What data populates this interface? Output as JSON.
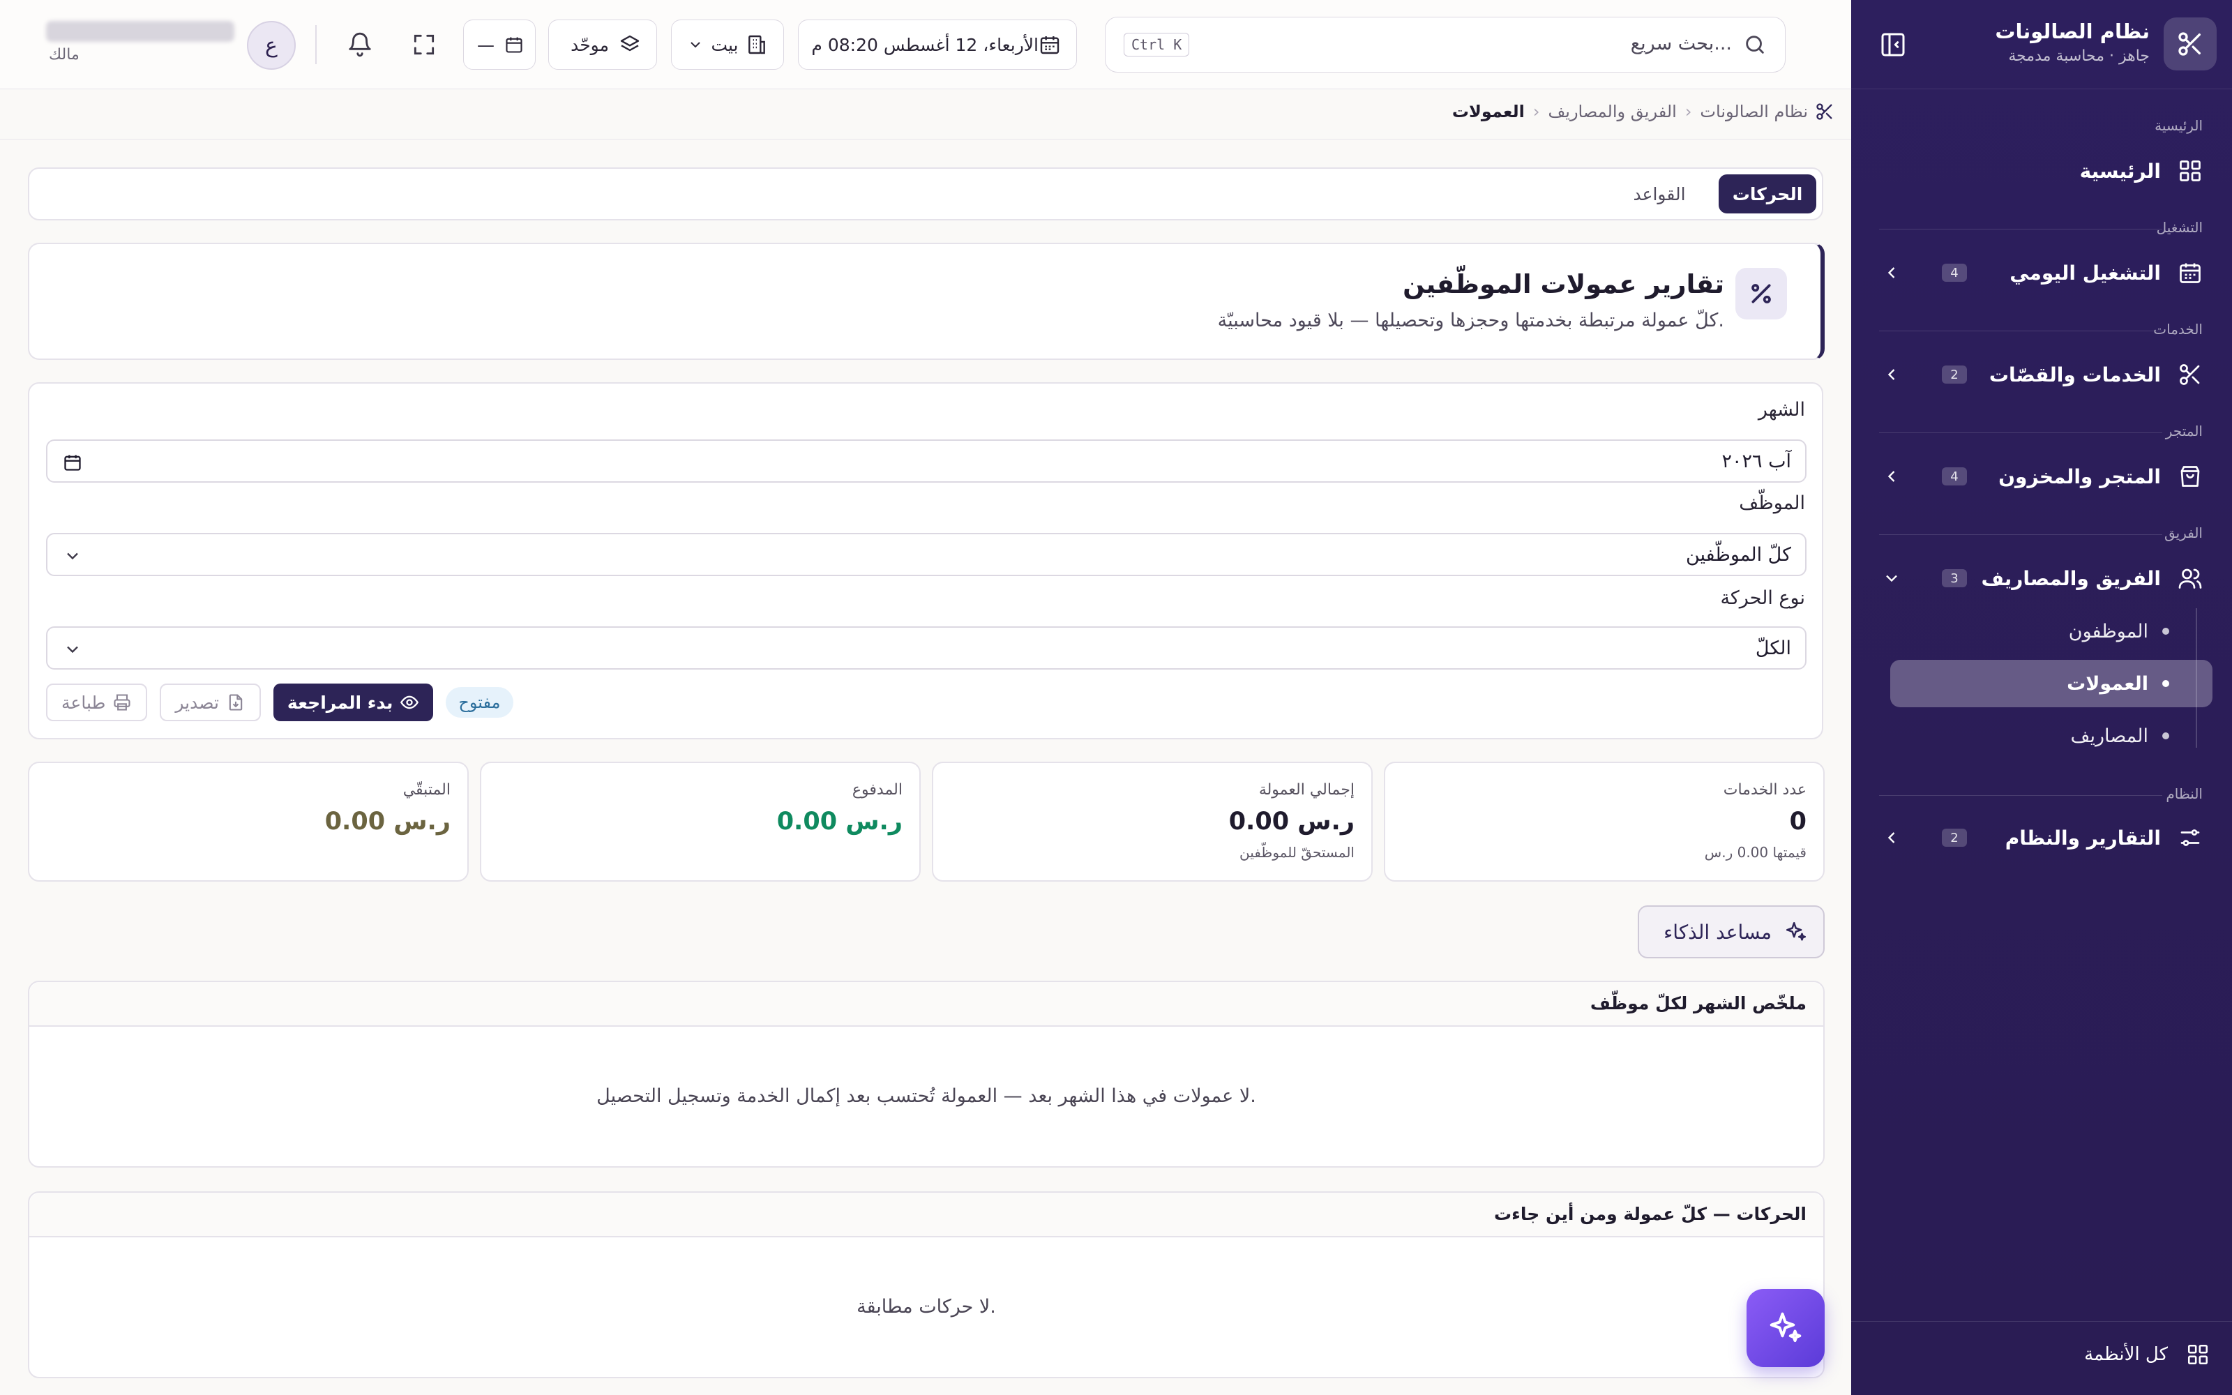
{
  "app": {
    "title": "نظام الصالونات",
    "subtitle": "جاهز · محاسبة مدمجة"
  },
  "topbar": {
    "search_placeholder": "بحث سريع...",
    "shortcut": "Ctrl K",
    "datetime": "الأربعاء، 12 أغسطس   08:20 م",
    "branch": "بيت",
    "mode": "موحّد",
    "date_short": "—",
    "avatar_initial": "ع",
    "user_role": "مالك"
  },
  "breadcrumb": {
    "items": [
      "نظام الصالونات",
      "الفريق والمصاريف",
      "العمولات"
    ],
    "separator": "›"
  },
  "tabs": {
    "active": "الحركات",
    "inactive": "القواعد"
  },
  "hero": {
    "title": "تقارير عمولات الموظّفين",
    "subtitle": "كلّ عمولة مرتبطة بخدمتها وحجزها وتحصيلها — بلا قيود محاسبيّة."
  },
  "filters": {
    "month_label": "الشهر",
    "month_value": "آب ٢٠٢٦",
    "employee_label": "الموظّف",
    "employee_value": "كلّ الموظّفين",
    "type_label": "نوع الحركة",
    "type_value": "الكلّ",
    "status_badge": "مفتوح",
    "review_button": "بدء المراجعة",
    "export_button": "تصدير",
    "print_button": "طباعة"
  },
  "stats": [
    {
      "label": "عدد الخدمات",
      "value": "0",
      "note": "قيمتها 0.00 ر.س"
    },
    {
      "label": "إجمالي العمولة",
      "value": "0.00 ر.س",
      "note": "المستحقّ للموظّفين"
    },
    {
      "label": "المدفوع",
      "value": "0.00 ر.س",
      "note": ""
    },
    {
      "label": "المتبقّي",
      "value": "0.00 ر.س",
      "note": ""
    }
  ],
  "ai_button": "مساعد الذكاء",
  "summary_panel": {
    "title": "ملخّص الشهر لكلّ موظّف",
    "empty": "لا عمولات في هذا الشهر بعد — العمولة تُحتسب بعد إكمال الخدمة وتسجيل التحصيل."
  },
  "movements_panel": {
    "title": "الحركات — كلّ عمولة ومن أين جاءت",
    "empty": "لا حركات مطابقة."
  },
  "sidebar": {
    "sections": {
      "home": "الرئيسية",
      "ops": "التشغيل",
      "services": "الخدمات",
      "store": "المتجر",
      "team": "الفريق",
      "system": "النظام"
    },
    "items": {
      "home": {
        "label": "الرئيسية"
      },
      "daily": {
        "label": "التشغيل اليومي",
        "count": "4"
      },
      "services": {
        "label": "الخدمات والقصّات",
        "count": "2"
      },
      "store": {
        "label": "المتجر والمخزون",
        "count": "4"
      },
      "team": {
        "label": "الفريق والمصاريف",
        "count": "3"
      },
      "reports": {
        "label": "التقارير والنظام",
        "count": "2"
      }
    },
    "team_children": [
      "الموظفون",
      "العمولات",
      "المصاريف"
    ],
    "footer": "كل الأنظمة"
  },
  "colors": {
    "sidebar": "#2d1f5e",
    "primary": "#2d2457",
    "paid_green": "#0f8a5f",
    "remaining_olive": "#6b6440"
  }
}
